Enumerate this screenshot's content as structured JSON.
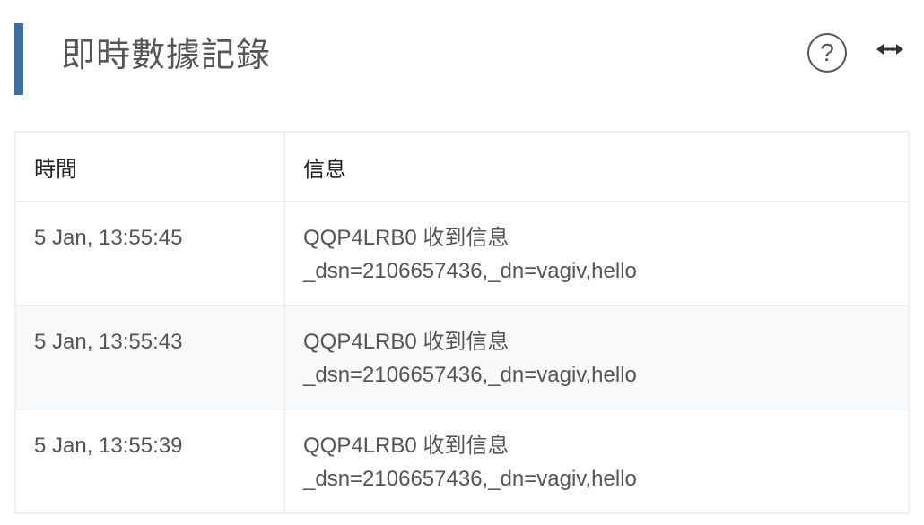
{
  "header": {
    "title": "即時數據記錄",
    "help_icon": "question-circle-icon",
    "expand_icon": "horizontal-arrows-icon"
  },
  "table": {
    "columns": [
      "時間",
      "信息"
    ],
    "rows": [
      {
        "time": "5 Jan, 13:55:45",
        "message_line1": "QQP4LRB0 收到信息",
        "message_line2": "_dsn=2106657436,_dn=vagiv,hello"
      },
      {
        "time": "5 Jan, 13:55:43",
        "message_line1": "QQP4LRB0 收到信息",
        "message_line2": "_dsn=2106657436,_dn=vagiv,hello"
      },
      {
        "time": "5 Jan, 13:55:39",
        "message_line1": "QQP4LRB0 收到信息",
        "message_line2": "_dsn=2106657436,_dn=vagiv,hello"
      }
    ]
  },
  "colors": {
    "accent": "#3a6ea5",
    "row_alt_bg": "#f8f9fb",
    "border": "#f0f0f0"
  }
}
